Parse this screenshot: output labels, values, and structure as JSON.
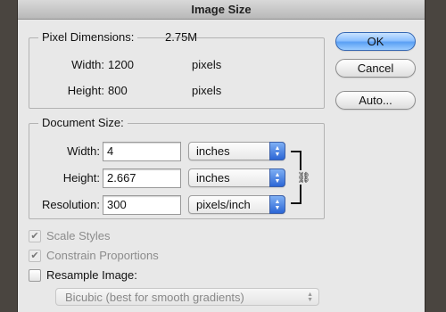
{
  "window": {
    "title": "Image Size"
  },
  "pixel_dimensions": {
    "title": "Pixel Dimensions:",
    "value": "2.75M",
    "width_label": "Width:",
    "width_value": "1200",
    "width_unit": "pixels",
    "height_label": "Height:",
    "height_value": "800",
    "height_unit": "pixels"
  },
  "document_size": {
    "title": "Document Size:",
    "width_label": "Width:",
    "width_value": "4",
    "width_unit": "inches",
    "height_label": "Height:",
    "height_value": "2.667",
    "height_unit": "inches",
    "resolution_label": "Resolution:",
    "resolution_value": "300",
    "resolution_unit": "pixels/inch"
  },
  "buttons": {
    "ok": "OK",
    "cancel": "Cancel",
    "auto": "Auto..."
  },
  "options": {
    "scale_styles": "Scale Styles",
    "constrain_proportions": "Constrain Proportions",
    "resample_image": "Resample Image:",
    "resample_method": "Bicubic (best for smooth gradients)"
  },
  "state": {
    "scale_styles_checked": true,
    "constrain_proportions_checked": true,
    "resample_image_checked": false
  },
  "icons": {
    "popup_arrow": "up-down-arrows",
    "check": "checkmark",
    "link": "chain-link"
  }
}
